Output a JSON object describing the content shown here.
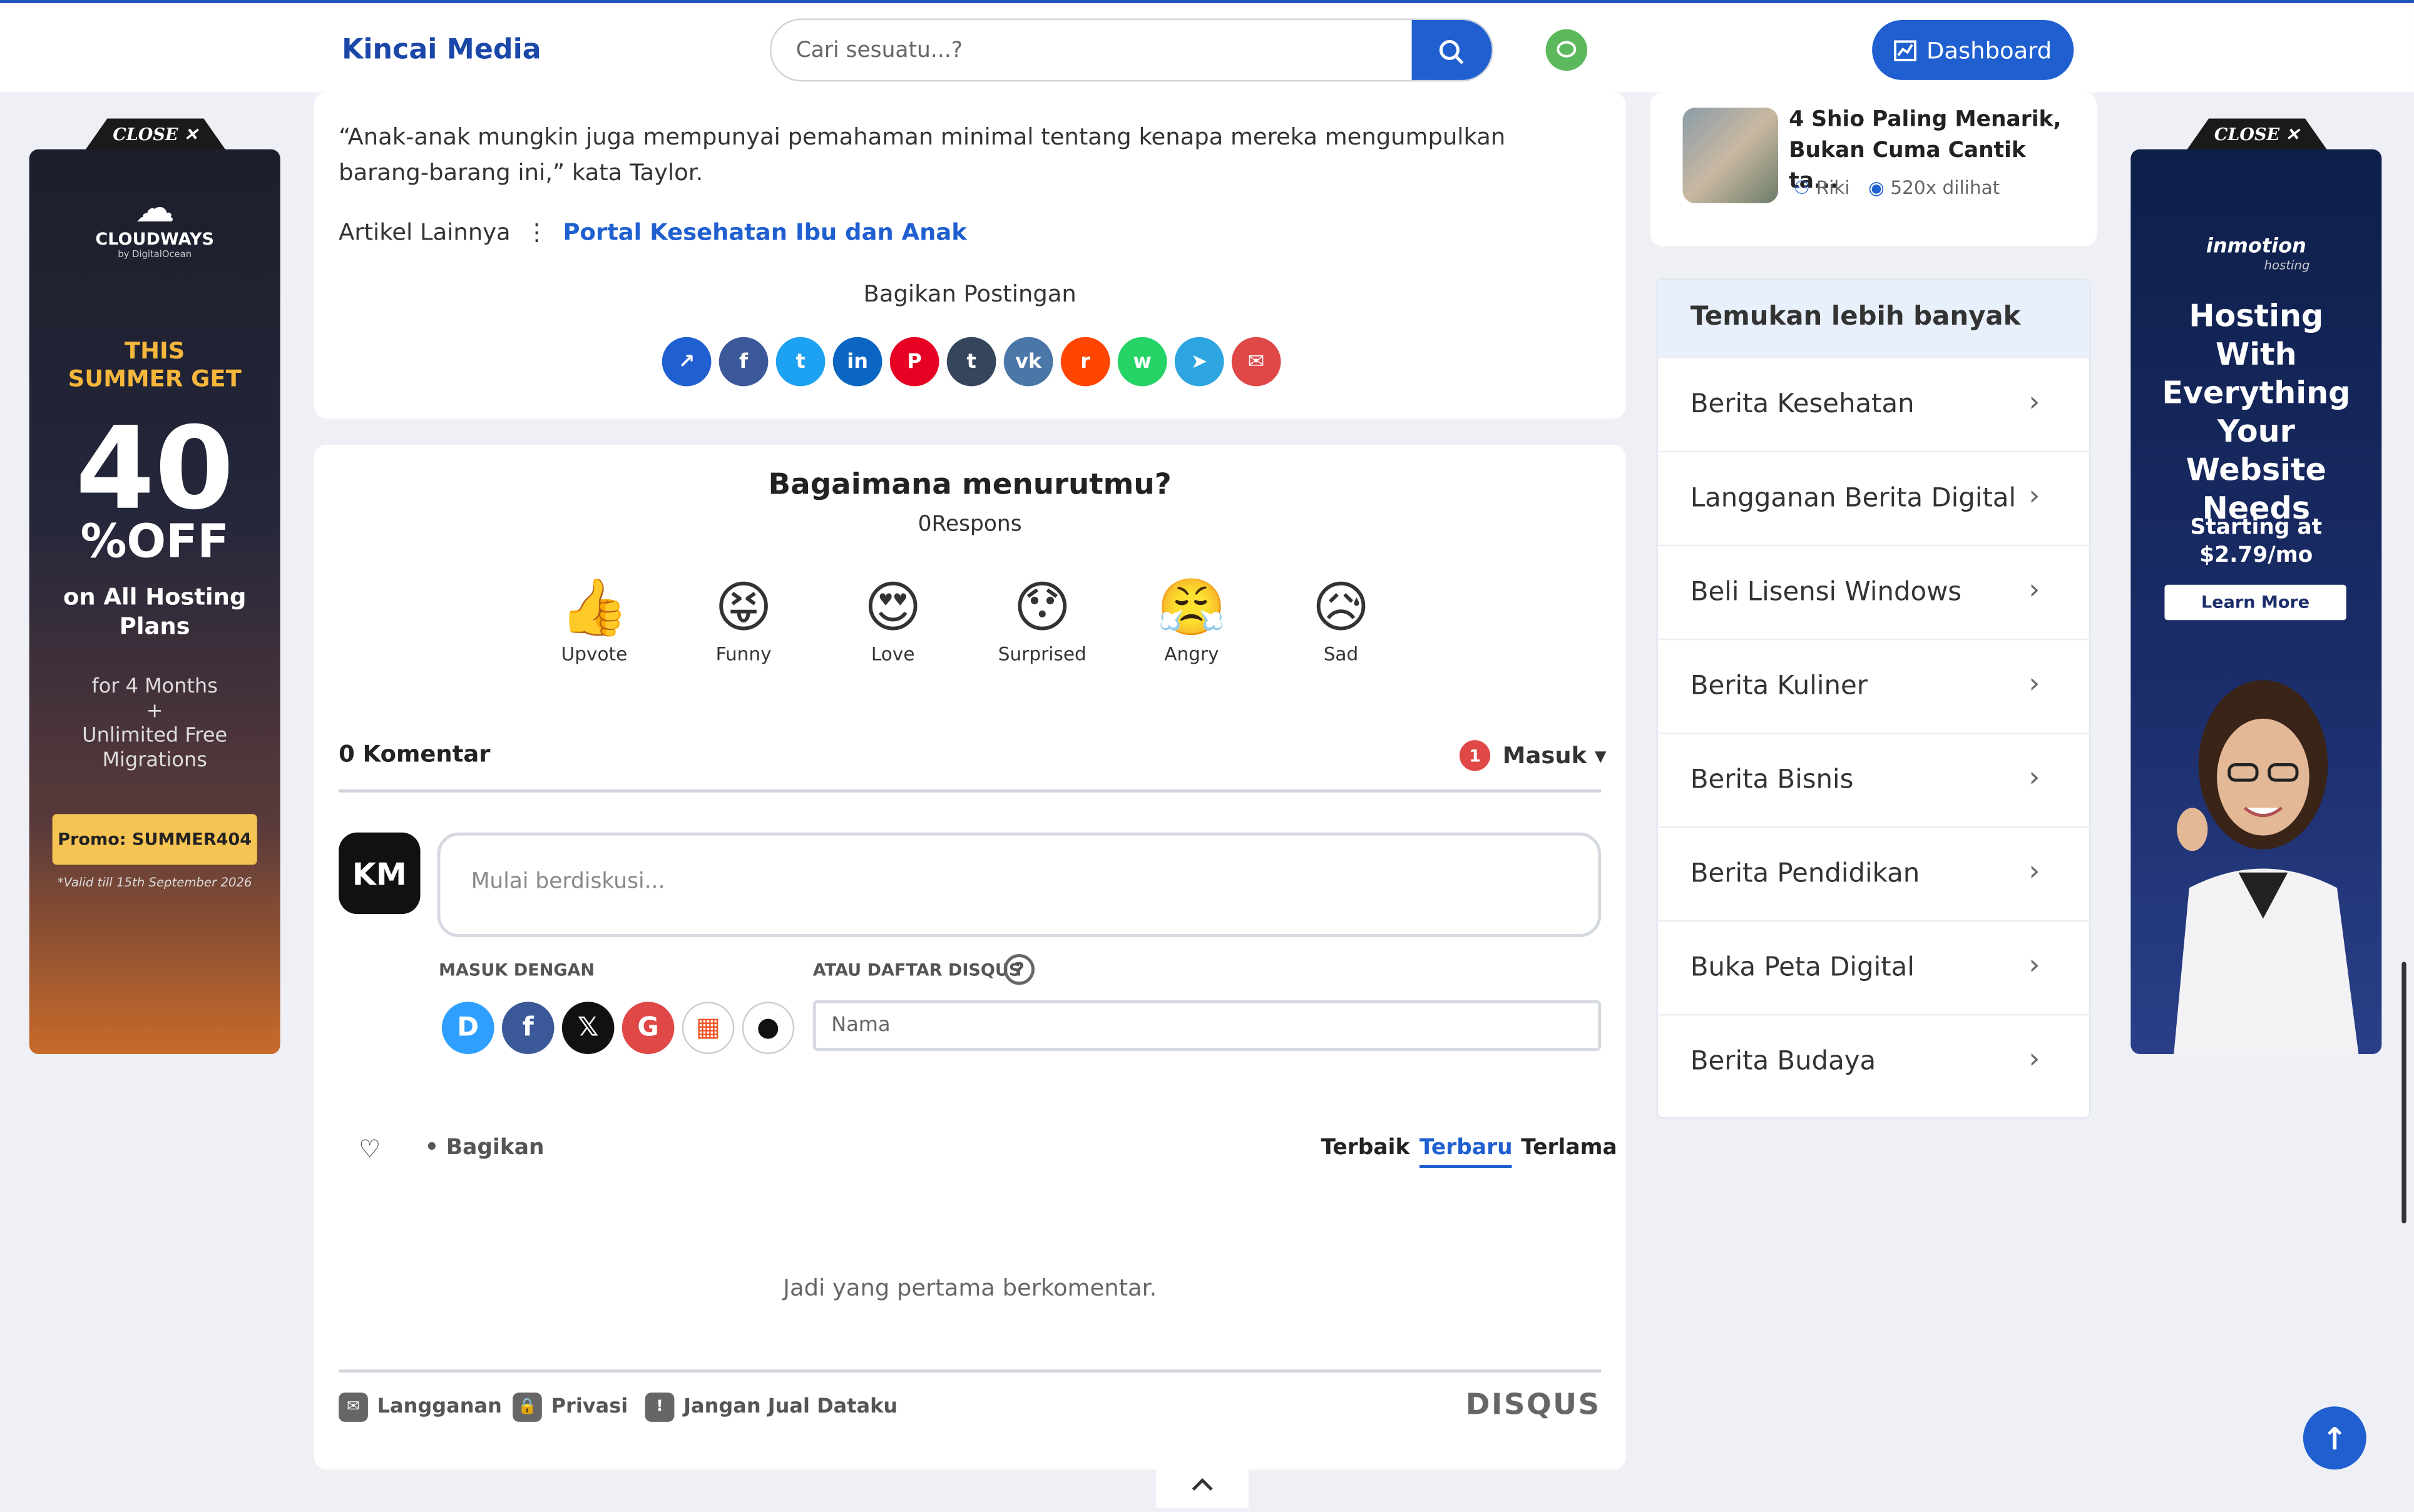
{
  "header": {
    "logo": "Kincai Media",
    "search_placeholder": "Cari sesuatu...?",
    "dashboard_label": "Dashboard"
  },
  "article": {
    "quote": "“Anak-anak mungkin juga mempunyai pemahaman minimal tentang kenapa mereka mengumpulkan barang-barang ini,” kata Taylor.",
    "more_label": "Artikel Lainnya",
    "more_sep": "⋮",
    "more_link": "Portal Kesehatan Ibu dan Anak",
    "share_heading": "Bagikan Postingan",
    "share_buttons": [
      {
        "icon": "share-icon",
        "glyph": "↗",
        "color": "#1f5fd0"
      },
      {
        "icon": "facebook-icon",
        "glyph": "f",
        "color": "#3b5998"
      },
      {
        "icon": "twitter-icon",
        "glyph": "t",
        "color": "#1da1f2"
      },
      {
        "icon": "linkedin-icon",
        "glyph": "in",
        "color": "#0a66c2"
      },
      {
        "icon": "pinterest-icon",
        "glyph": "P",
        "color": "#e60023"
      },
      {
        "icon": "tumblr-icon",
        "glyph": "t",
        "color": "#35465c"
      },
      {
        "icon": "vk-icon",
        "glyph": "vk",
        "color": "#4a76a8"
      },
      {
        "icon": "reddit-icon",
        "glyph": "r",
        "color": "#ff4500"
      },
      {
        "icon": "whatsapp-icon",
        "glyph": "w",
        "color": "#25d366"
      },
      {
        "icon": "telegram-icon",
        "glyph": "➤",
        "color": "#2ca5e0"
      },
      {
        "icon": "email-icon",
        "glyph": "✉",
        "color": "#e04848"
      }
    ]
  },
  "reactions": {
    "question": "Bagaimana menurutmu?",
    "count_label": "0Respons",
    "items": [
      {
        "label": "Upvote",
        "emoji": "👍"
      },
      {
        "label": "Funny",
        "emoji": "😝"
      },
      {
        "label": "Love",
        "emoji": "😍"
      },
      {
        "label": "Surprised",
        "emoji": "😯"
      },
      {
        "label": "Angry",
        "emoji": "😤"
      },
      {
        "label": "Sad",
        "emoji": "😥"
      }
    ]
  },
  "comments": {
    "count_label": "0 Komentar",
    "notif_count": "1",
    "login_label": "Masuk ▾",
    "avatar_text": "KM",
    "input_placeholder": "Mulai berdiskusi...",
    "login_with": "MASUK DENGAN",
    "or_register": "ATAU DAFTAR DISQUS",
    "help": "?",
    "name_placeholder": "Nama",
    "social": [
      {
        "icon": "disqus-icon",
        "glyph": "D",
        "color": "#2e9fff",
        "fg": "#fff"
      },
      {
        "icon": "facebook-icon",
        "glyph": "f",
        "color": "#3b5998",
        "fg": "#fff"
      },
      {
        "icon": "x-icon",
        "glyph": "𝕏",
        "color": "#111",
        "fg": "#fff"
      },
      {
        "icon": "google-icon",
        "glyph": "G",
        "color": "#e04848",
        "fg": "#fff"
      },
      {
        "icon": "microsoft-icon",
        "glyph": "▦",
        "color": "#fff",
        "fg": "#f25022"
      },
      {
        "icon": "apple-icon",
        "glyph": "●",
        "color": "#fff",
        "fg": "#111"
      }
    ],
    "heart": "♡",
    "share_label": "•  Bagikan",
    "sort": {
      "best": "Terbaik",
      "newest": "Terbaru",
      "oldest": "Terlama"
    },
    "empty": "Jadi yang pertama berkomentar.",
    "footer": {
      "subscribe": "Langganan",
      "privacy": "Privasi",
      "dont_sell": "Jangan Jual Dataku",
      "brand": "DISQUS"
    }
  },
  "sidebar": {
    "popular": {
      "title": "4 Shio Paling Menarik, Bukan Cuma Cantik ta...",
      "author": "Riki",
      "views": "520x dilihat"
    },
    "discover": {
      "heading": "Temukan lebih banyak",
      "items": [
        "Berita Kesehatan",
        "Langganan Berita Digital",
        "Beli Lisensi Windows",
        "Berita Kuliner",
        "Berita Bisnis",
        "Berita Pendidikan",
        "Buka Peta Digital",
        "Berita Budaya"
      ]
    }
  },
  "ads": {
    "close_label": "CLOSE ✕",
    "left": {
      "brand": "CLOUDWAYS",
      "brand_sub": "by DigitalOcean",
      "line1": "THIS SUMMER GET",
      "big": "40",
      "off": "%OFF",
      "line2": "on All Hosting Plans",
      "line3": "for 4 Months\n+\nUnlimited Free Migrations",
      "promo": "Promo: SUMMER404",
      "valid": "*Valid till 15th September 2026"
    },
    "right": {
      "brand": "inmotion",
      "brand_sub": "hosting",
      "headline": "Hosting With Everything Your Website Needs",
      "price": "Starting at $2.79/mo",
      "cta": "Learn More"
    }
  },
  "colors": {
    "accent": "#1f5fd0"
  }
}
